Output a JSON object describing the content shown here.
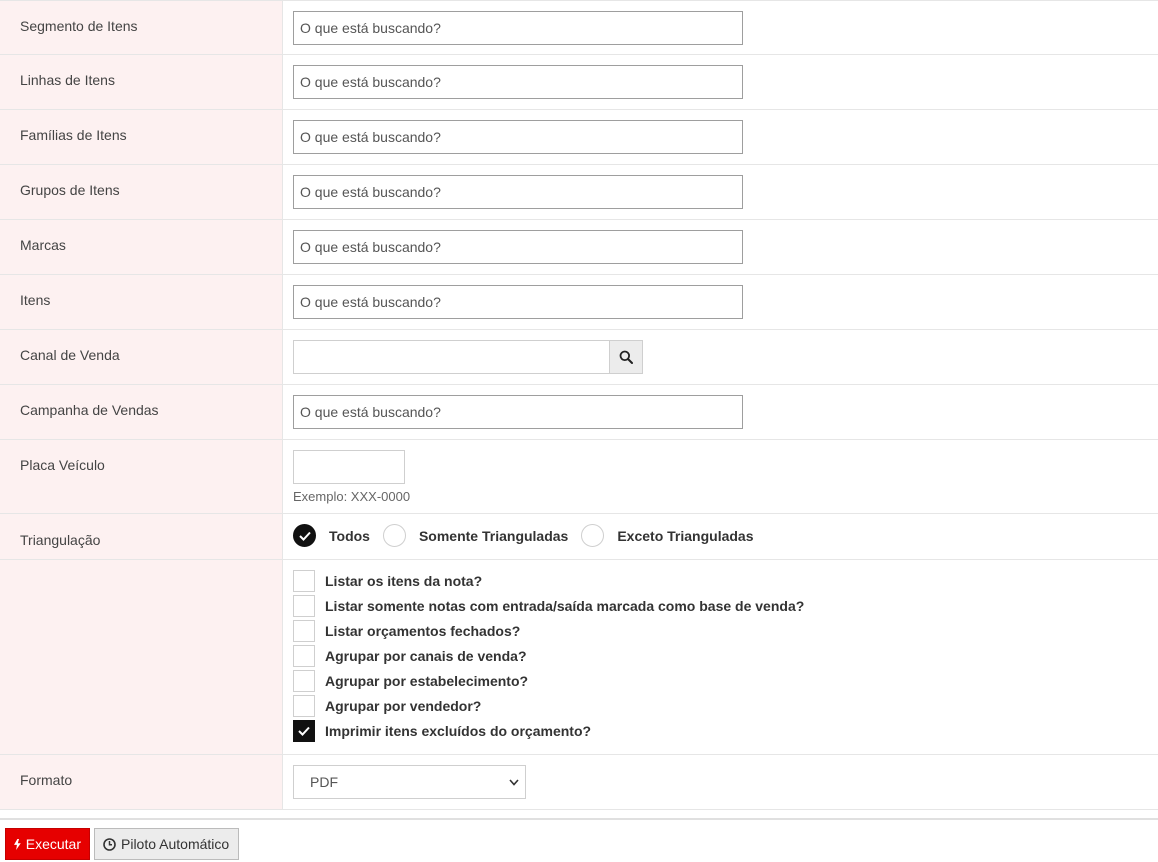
{
  "fields": [
    {
      "label": "Segmento de Itens",
      "placeholder": "O que está buscando?"
    },
    {
      "label": "Linhas de Itens",
      "placeholder": "O que está buscando?"
    },
    {
      "label": "Famílias de Itens",
      "placeholder": "O que está buscando?"
    },
    {
      "label": "Grupos de Itens",
      "placeholder": "O que está buscando?"
    },
    {
      "label": "Marcas",
      "placeholder": "O que está buscando?"
    },
    {
      "label": "Itens",
      "placeholder": "O que está buscando?"
    }
  ],
  "canal": {
    "label": "Canal de Venda",
    "value": "",
    "icon": "search-icon"
  },
  "campanha": {
    "label": "Campanha de Vendas",
    "placeholder": "O que está buscando?"
  },
  "placa": {
    "label": "Placa Veículo",
    "value": "",
    "help": "Exemplo: XXX-0000"
  },
  "triangulacao": {
    "label": "Triangulação",
    "options": [
      {
        "label": "Todos",
        "checked": true
      },
      {
        "label": "Somente Trianguladas",
        "checked": false
      },
      {
        "label": "Exceto Trianguladas",
        "checked": false
      }
    ]
  },
  "options": [
    {
      "label": "Listar os itens da nota?",
      "checked": false
    },
    {
      "label": "Listar somente notas com entrada/saída marcada como base de venda?",
      "checked": false
    },
    {
      "label": "Listar orçamentos fechados?",
      "checked": false
    },
    {
      "label": "Agrupar por canais de venda?",
      "checked": false
    },
    {
      "label": "Agrupar por estabelecimento?",
      "checked": false
    },
    {
      "label": "Agrupar por vendedor?",
      "checked": false
    },
    {
      "label": "Imprimir itens excluídos do orçamento?",
      "checked": true
    }
  ],
  "formato": {
    "label": "Formato",
    "selected": "PDF"
  },
  "buttons": {
    "execute": "Executar",
    "autopilot": "Piloto Automático"
  },
  "colors": {
    "label_bg": "#fdf1f1",
    "execute_bg": "#e60000",
    "checked": "#111111"
  }
}
